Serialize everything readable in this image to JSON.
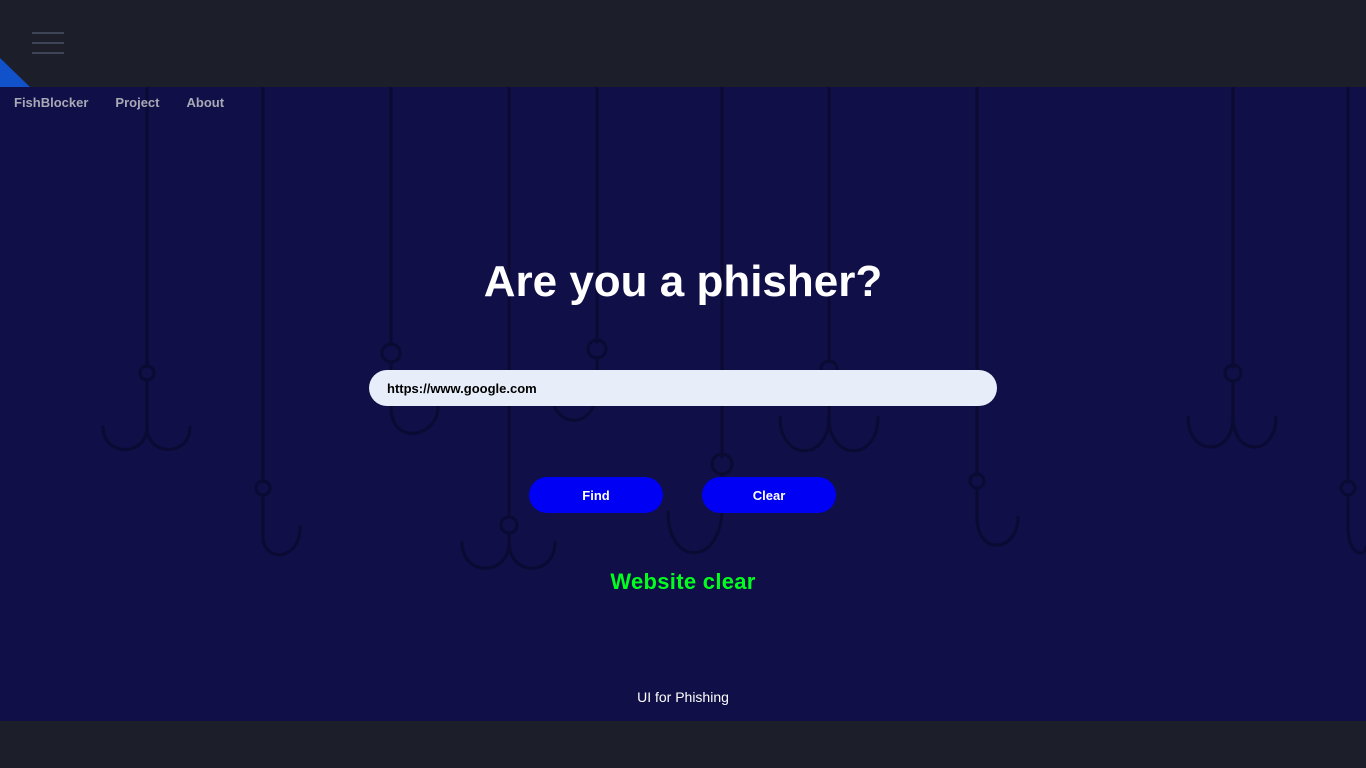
{
  "nav": {
    "menu_icon": "hamburger-menu-icon",
    "links": [
      "FishBlocker",
      "Project",
      "About"
    ]
  },
  "hero": {
    "title": "Are you a phisher?",
    "url_input_value": "https://www.google.com",
    "find_label": "Find",
    "clear_label": "Clear",
    "result_text": "Website clear",
    "footer_text": "UI for Phishing"
  },
  "colors": {
    "topbar": "#1c1f29",
    "hero_bg": "#100f47",
    "button": "#0000f5",
    "result": "#00ff1e",
    "corner_accent": "#1151c9"
  }
}
